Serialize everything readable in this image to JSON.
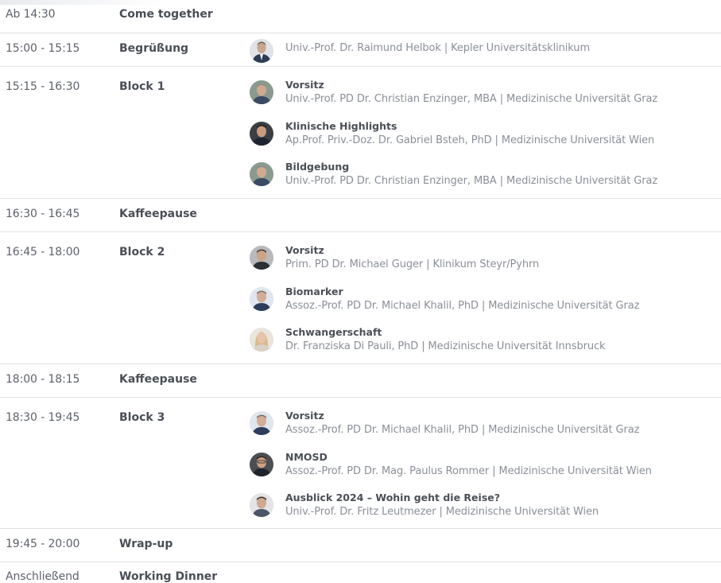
{
  "schedule": [
    {
      "time": "Ab 14:30",
      "title": "Come together",
      "entries": []
    },
    {
      "time": "15:00 - 15:15",
      "title": "Begrüßung",
      "entries": [
        {
          "role": "",
          "speaker": "Univ.-Prof. Dr. Raimund Helbok | Kepler Universitätsklinikum",
          "avatar": "speaker-photo"
        }
      ]
    },
    {
      "time": "15:15 - 16:30",
      "title": "Block 1",
      "entries": [
        {
          "role": "Vorsitz",
          "speaker": "Univ.-Prof. PD Dr. Christian Enzinger, MBA | Medizinische Universität Graz",
          "avatar": "speaker-photo"
        },
        {
          "role": "Klinische Highlights",
          "speaker": "Ap.Prof. Priv.-Doz. Dr. Gabriel Bsteh, PhD | Medizinische Universität Wien",
          "avatar": "speaker-photo"
        },
        {
          "role": "Bildgebung",
          "speaker": "Univ.-Prof. PD Dr. Christian Enzinger, MBA | Medizinische Universität Graz",
          "avatar": "speaker-photo"
        }
      ]
    },
    {
      "time": "16:30 - 16:45",
      "title": "Kaffeepause",
      "entries": []
    },
    {
      "time": "16:45 - 18:00",
      "title": "Block 2",
      "entries": [
        {
          "role": "Vorsitz",
          "speaker": "Prim. PD Dr. Michael Guger | Klinikum Steyr/Pyhrn",
          "avatar": "speaker-photo"
        },
        {
          "role": "Biomarker",
          "speaker": "Assoz.-Prof. PD Dr. Michael Khalil, PhD | Medizinische Universität Graz",
          "avatar": "speaker-photo"
        },
        {
          "role": "Schwangerschaft",
          "speaker": "Dr. Franziska Di Pauli, PhD | Medizinische Universität Innsbruck",
          "avatar": "speaker-photo"
        }
      ]
    },
    {
      "time": "18:00 - 18:15",
      "title": "Kaffeepause",
      "entries": []
    },
    {
      "time": "18:30 - 19:45",
      "title": "Block 3",
      "entries": [
        {
          "role": "Vorsitz",
          "speaker": "Assoz.-Prof. PD Dr. Michael Khalil, PhD | Medizinische Universität Graz",
          "avatar": "speaker-photo"
        },
        {
          "role": "NMOSD",
          "speaker": "Assoz.-Prof. PD Dr. Mag. Paulus Rommer | Medizinische Universität Wien",
          "avatar": "speaker-photo"
        },
        {
          "role": "Ausblick 2024 – Wohin geht die Reise?",
          "speaker": "Univ.-Prof. Dr. Fritz Leutmezer | Medizinische Universität Wien",
          "avatar": "speaker-photo"
        }
      ]
    },
    {
      "time": "19:45 - 20:00",
      "title": "Wrap-up",
      "entries": []
    },
    {
      "time": "Anschließend",
      "title": "Working Dinner",
      "entries": []
    }
  ],
  "colors": {
    "background": "#ffffff",
    "separator": "#dfe2e6",
    "title_text": "#4a4f57",
    "time_text": "#5d626a",
    "speaker_text": "#8a8f97"
  }
}
